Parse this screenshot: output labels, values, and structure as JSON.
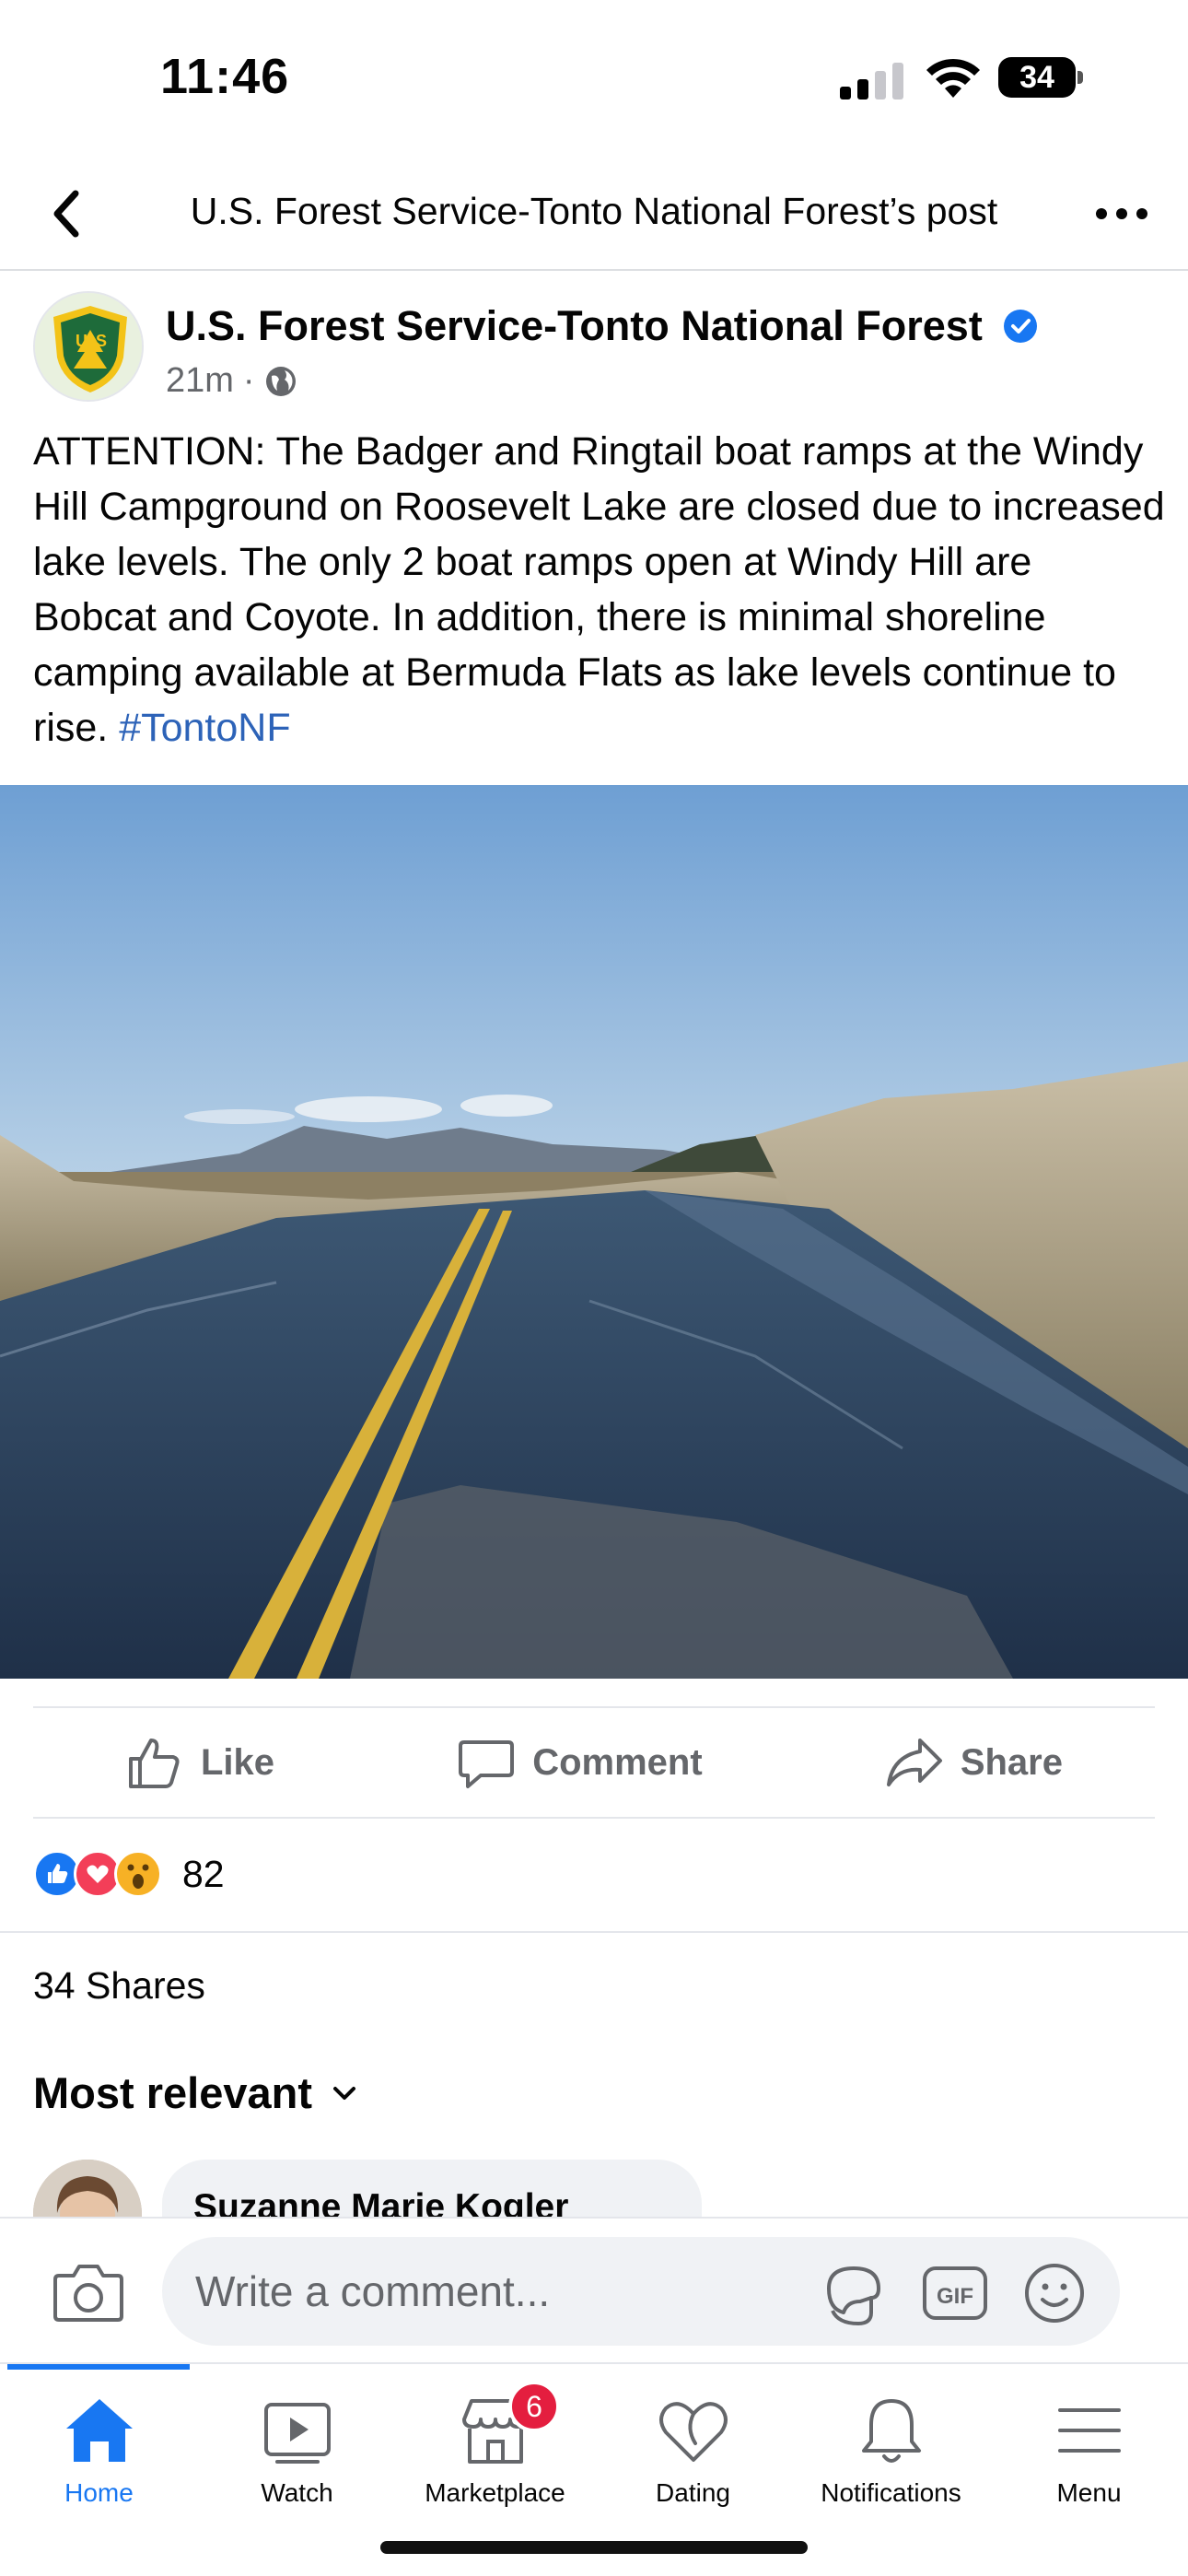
{
  "status_bar": {
    "time": "11:46",
    "battery": "34"
  },
  "header": {
    "title": "U.S. Forest Service-Tonto National Forest’s post"
  },
  "post": {
    "author": "U.S. Forest Service-Tonto National Forest",
    "time": "21m",
    "separator": "·",
    "text": "ATTENTION: The Badger and Ringtail boat ramps at the Windy Hill Campground on Roosevelt Lake are closed due to increased lake levels. The only 2 boat ramps open at Windy Hill are Bobcat and Coyote. In addition, there is minimal shoreline camping available at Bermuda Flats as lake levels continue to rise. ",
    "hashtag": "#TontoNF",
    "image_alt": "Flooded road with double yellow center lines near a lake, mountains in background"
  },
  "actions": {
    "like": "Like",
    "comment": "Comment",
    "share": "Share"
  },
  "reactions": {
    "count": "82",
    "types": [
      "like",
      "love",
      "wow"
    ]
  },
  "shares": "34 Shares",
  "sort": {
    "label": "Most relevant"
  },
  "comments": [
    {
      "author": "Suzanne Marie Kogler"
    }
  ],
  "composer": {
    "placeholder": "Write a comment..."
  },
  "nav": {
    "items": [
      {
        "label": "Home",
        "icon": "home-icon",
        "active": true
      },
      {
        "label": "Watch",
        "icon": "watch-icon"
      },
      {
        "label": "Marketplace",
        "icon": "marketplace-icon",
        "badge": "6"
      },
      {
        "label": "Dating",
        "icon": "dating-icon"
      },
      {
        "label": "Notifications",
        "icon": "bell-icon"
      },
      {
        "label": "Menu",
        "icon": "menu-icon"
      }
    ]
  },
  "colors": {
    "accent": "#1877f2",
    "hashtag": "#2d63b8",
    "badge": "#e41e3f",
    "muted": "#65676b"
  }
}
